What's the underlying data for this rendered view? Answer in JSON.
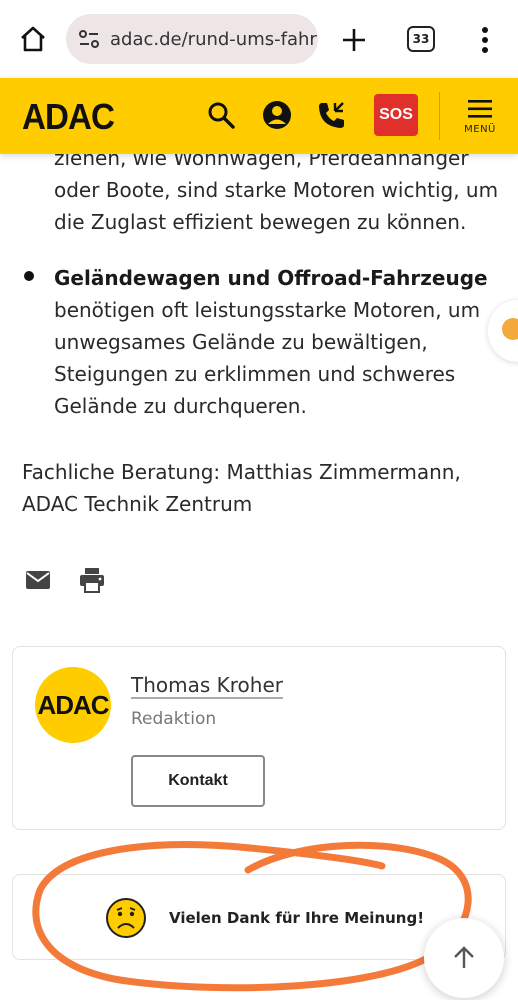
{
  "browser": {
    "url": "adac.de/rund-ums-fahr",
    "tab_count": "33"
  },
  "header": {
    "logo": "ADAC",
    "sos_label": "SOS",
    "menu_label": "MENÜ",
    "brand_color": "#ffcc00",
    "sos_color": "#e0302b"
  },
  "article": {
    "top_paragraph": "ziehen, wie Wohnwagen, Pferdeanhänger oder Boote, sind starke Motoren wichtig, um die Zuglast effizient bewegen zu können.",
    "bullet_title": "Geländewagen und Offroad-Fahrzeuge",
    "bullet_body": " benötigen oft leistungsstarke Motoren, um unwegsames Gelände zu bewältigen, Steigungen zu erklimmen und schweres Gelände zu durchqueren.",
    "advice": "Fachliche Beratung: Matthias Zimmermann, ADAC Technik Zentrum"
  },
  "share": {
    "icons": [
      "mail-icon",
      "print-icon"
    ]
  },
  "author": {
    "avatar_text": "ADAC",
    "name": "Thomas Kroher",
    "role": "Redaktion",
    "contact_label": "Kontakt"
  },
  "feedback": {
    "message": "Vielen Dank für Ihre Meinung!",
    "icon": "sad-face-icon"
  },
  "annotation_color": "#f47a3a"
}
